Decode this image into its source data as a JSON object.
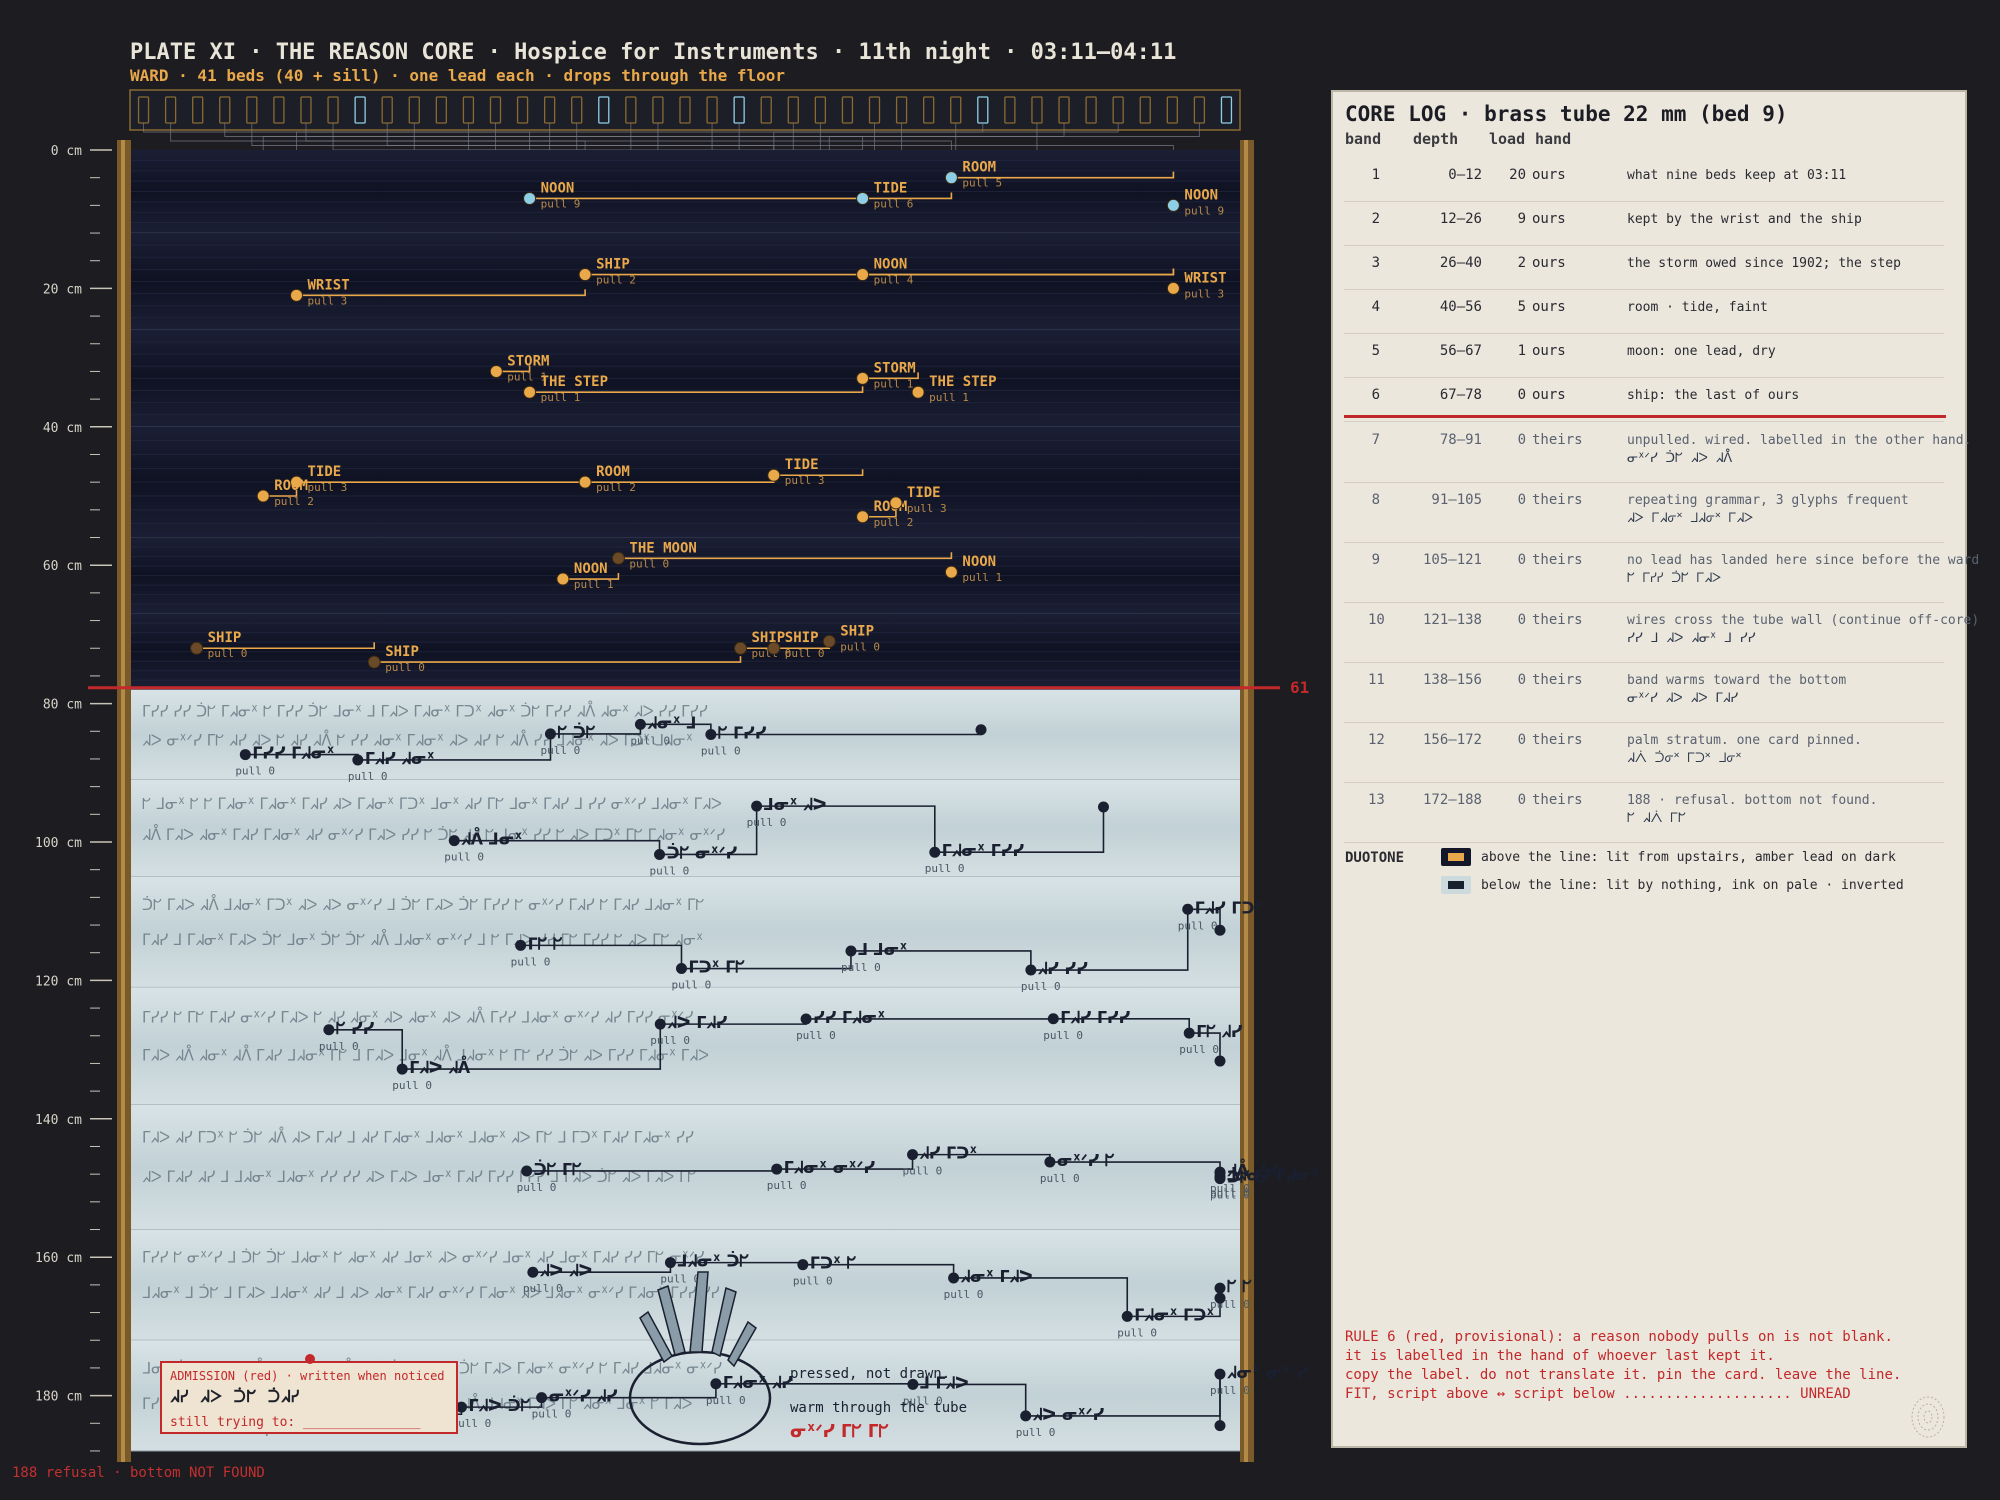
{
  "header": {
    "title": "PLATE XI · THE REASON CORE · Hospice for Instruments · 11th night · 03:11–04:11",
    "subtitle": "WARD · 41 beds (40 + sill) · one lead each · drops through the floor"
  },
  "ward": {
    "beds": 41,
    "lit_beds": [
      8,
      17,
      22,
      31,
      40
    ]
  },
  "depth_axis": {
    "labels": [
      "0 cm",
      "20 cm",
      "40 cm",
      "60 cm",
      "80 cm",
      "100 cm",
      "120 cm",
      "140 cm",
      "160 cm",
      "180 cm"
    ],
    "max_cm": 188
  },
  "surface_line": {
    "depth_cm": 78,
    "label": "61 c"
  },
  "colors": {
    "amber": "#e9a84a",
    "dark_band": "#14172a",
    "pale_band": "#cddadd",
    "ink": "#1a2030",
    "red": "#c3282a",
    "brass": "#8a6a30"
  },
  "upper_leads": [
    {
      "word": "NOON",
      "pull": "pull 9",
      "x": 0.36,
      "d": 7,
      "end": 0.66,
      "hl": true
    },
    {
      "word": "TIDE",
      "pull": "pull 6",
      "x": 0.66,
      "d": 7,
      "end": 0.74,
      "hl": true
    },
    {
      "word": "ROOM",
      "pull": "pull 5",
      "x": 0.74,
      "d": 4,
      "end": 0.94,
      "hl": true
    },
    {
      "word": "NOON",
      "pull": "pull 9",
      "x": 0.94,
      "d": 8,
      "end": 0.94,
      "hl": true
    },
    {
      "word": "SHIP",
      "pull": "pull 2",
      "x": 0.41,
      "d": 18,
      "end": 0.94
    },
    {
      "word": "NOON",
      "pull": "pull 4",
      "x": 0.66,
      "d": 18,
      "end": 0.94
    },
    {
      "word": "WRIST",
      "pull": "pull 3",
      "x": 0.94,
      "d": 20,
      "end": 0.94
    },
    {
      "word": "WRIST",
      "pull": "pull 3",
      "x": 0.15,
      "d": 21,
      "end": 0.41
    },
    {
      "word": "STORM",
      "pull": "pull 1",
      "x": 0.33,
      "d": 32,
      "end": 0.36
    },
    {
      "word": "THE STEP",
      "pull": "pull 1",
      "x": 0.36,
      "d": 35,
      "end": 0.66
    },
    {
      "word": "STORM",
      "pull": "pull 1",
      "x": 0.66,
      "d": 33,
      "end": 0.71
    },
    {
      "word": "THE STEP",
      "pull": "pull 1",
      "x": 0.71,
      "d": 35,
      "end": 0.71
    },
    {
      "word": "TIDE",
      "pull": "pull 3",
      "x": 0.15,
      "d": 48,
      "end": 0.41
    },
    {
      "word": "ROOM",
      "pull": "pull 2",
      "x": 0.12,
      "d": 50,
      "end": 0.15
    },
    {
      "word": "ROOM",
      "pull": "pull 2",
      "x": 0.41,
      "d": 48,
      "end": 0.58
    },
    {
      "word": "TIDE",
      "pull": "pull 3",
      "x": 0.58,
      "d": 47,
      "end": 0.66
    },
    {
      "word": "ROOM",
      "pull": "pull 2",
      "x": 0.66,
      "d": 53,
      "end": 0.69
    },
    {
      "word": "TIDE",
      "pull": "pull 3",
      "x": 0.69,
      "d": 51,
      "end": 0.69
    },
    {
      "word": "THE MOON",
      "pull": "pull 0",
      "x": 0.44,
      "d": 59,
      "end": 0.74
    },
    {
      "word": "NOON",
      "pull": "pull 1",
      "x": 0.39,
      "d": 62,
      "end": 0.44
    },
    {
      "word": "NOON",
      "pull": "pull 1",
      "x": 0.74,
      "d": 61,
      "end": 0.74
    },
    {
      "word": "SHIP",
      "pull": "pull 0",
      "x": 0.06,
      "d": 72,
      "end": 0.22
    },
    {
      "word": "SHIP",
      "pull": "pull 0",
      "x": 0.22,
      "d": 74,
      "end": 0.55
    },
    {
      "word": "SHIP",
      "pull": "pull 0",
      "x": 0.55,
      "d": 72,
      "end": 0.58
    },
    {
      "word": "SHIP",
      "pull": "pull 0",
      "x": 0.58,
      "d": 72,
      "end": 0.63
    },
    {
      "word": "SHIP",
      "pull": "pull 0",
      "x": 0.63,
      "d": 71,
      "end": 0.63
    }
  ],
  "lower_pull_label": "pull 0",
  "bands": [
    {
      "band": "1",
      "depth": "0–12",
      "load": "20",
      "hand": "ours",
      "note": "what nine beds keep at 03:11",
      "glyphs": ""
    },
    {
      "band": "2",
      "depth": "12–26",
      "load": "9",
      "hand": "ours",
      "note": "kept by the wrist and the ship",
      "glyphs": ""
    },
    {
      "band": "3",
      "depth": "26–40",
      "load": "2",
      "hand": "ours",
      "note": "the storm owed since 1902; the step",
      "glyphs": ""
    },
    {
      "band": "4",
      "depth": "40–56",
      "load": "5",
      "hand": "ours",
      "note": "room · tide, faint",
      "glyphs": ""
    },
    {
      "band": "5",
      "depth": "56–67",
      "load": "1",
      "hand": "ours",
      "note": "moon: one lead, dry",
      "glyphs": ""
    },
    {
      "band": "6",
      "depth": "67–78",
      "load": "0",
      "hand": "ours",
      "note": "ship: the last of ours",
      "glyphs": ""
    },
    {
      "band": "7",
      "depth": "78–91",
      "load": "0",
      "hand": "theirs",
      "note": "unpulled. wired. labelled in the other hand.",
      "glyphs": "ᓂᕽᐟᓯ ᑑᖸ ᖽᐳ ᖽᐰ"
    },
    {
      "band": "8",
      "depth": "91–105",
      "load": "0",
      "hand": "theirs",
      "note": "repeating grammar, 3 glyphs frequent",
      "glyphs": "ᖽᐳ ᒥᖽᓂᕽ ᒧᖽᓂᕽ ᒥᖽᐳ"
    },
    {
      "band": "9",
      "depth": "105–121",
      "load": "0",
      "hand": "theirs",
      "note": "no lead has landed here since before the ward",
      "glyphs": "ᖸ ᒥᓯᓯ ᑑᖸ ᒥᖽᐳ"
    },
    {
      "band": "10",
      "depth": "121–138",
      "load": "0",
      "hand": "theirs",
      "note": "wires cross the tube wall (continue off-core)",
      "glyphs": "ᓯᓯ ᒧ ᖽᐳ ᖽᓂᕽ ᒧ ᓯᓯ"
    },
    {
      "band": "11",
      "depth": "138–156",
      "load": "0",
      "hand": "theirs",
      "note": "band warms toward the bottom",
      "glyphs": "ᓂᕽᐟᓯ ᖽᐳ ᖽᐳ ᒥᖽᓯ"
    },
    {
      "band": "12",
      "depth": "156–172",
      "load": "0",
      "hand": "theirs",
      "note": "palm stratum. one card pinned.",
      "glyphs": "ᖽᐰ ᑑᓂᕽ ᒥᑐᕽ ᒧᓂᕽ"
    },
    {
      "band": "13",
      "depth": "172–188",
      "load": "0",
      "hand": "theirs",
      "note": "188 · refusal. bottom not found.",
      "glyphs": "ᖸ ᖽᐰ ᒥᖸ"
    }
  ],
  "log": {
    "title": "CORE LOG · brass tube 22 mm (bed 9)",
    "headers": [
      "band",
      "depth",
      "load",
      "hand"
    ],
    "duotone_label": "DUOTONE",
    "duotone_above": "above the line: lit from upstairs, amber lead on dark",
    "duotone_below": "below the line: lit by nothing, ink on pale · inverted",
    "rule6": [
      "RULE 6 (red, provisional): a reason nobody pulls on is not blank.",
      "it is labelled in the hand of whoever last kept it.",
      "copy the label. do not translate it. pin the card. leave the line.",
      "FIT, script above ↔ script below .................... UNREAD"
    ]
  },
  "admission": {
    "heading": "ADMISSION (red) · written when noticed",
    "glyphs": "ᖽᓯ ᖽᐳ ᑑᖸ ᑑᖽᓯ",
    "still": "still trying to: _______________"
  },
  "palm": {
    "text1": "pressed, not drawn.",
    "text2": "warm through the tube",
    "red_glyphs": "ᓂᕽᐟᓯ ᒥᖸ ᒥᖸ"
  },
  "footer": "188 refusal · bottom NOT FOUND"
}
